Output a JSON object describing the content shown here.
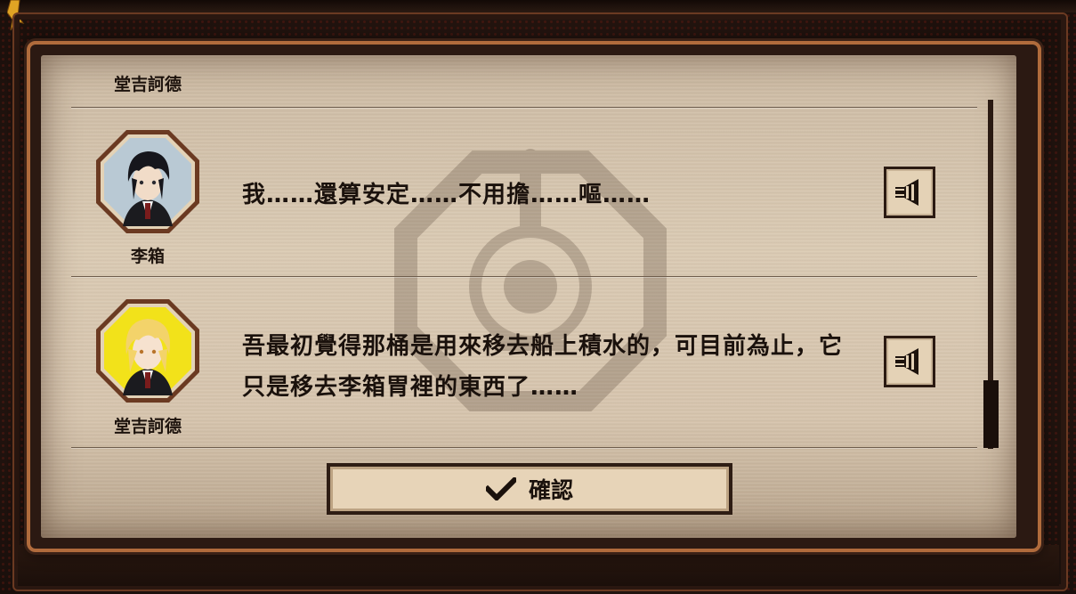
{
  "top": {
    "speaker_name": "堂吉訶德"
  },
  "entries": [
    {
      "speaker": "李箱",
      "text": "我……還算安定……不用擔……嘔……",
      "avatar": "dark-hair-character"
    },
    {
      "speaker": "堂吉訶德",
      "text": "吾最初覺得那桶是用來移去船上積水的，可目前為止，它只是移去李箱胃裡的東西了……",
      "avatar": "blonde-character"
    }
  ],
  "confirm": {
    "label": "確認",
    "icon": "check-icon"
  },
  "icons": {
    "voice": "speaker-icon"
  },
  "colors": {
    "panel": "#d7c5ae",
    "frame": "#b06b3c",
    "text": "#1a110c"
  }
}
